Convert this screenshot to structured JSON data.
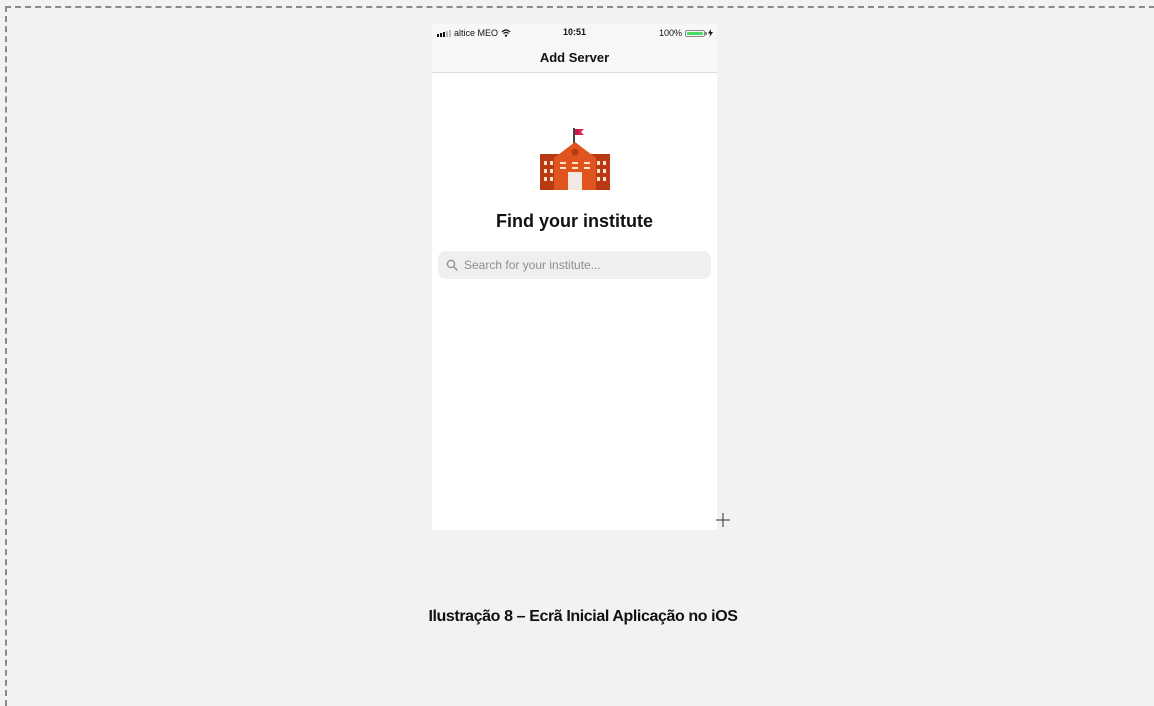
{
  "status_bar": {
    "carrier": "altice MEO",
    "time": "10:51",
    "battery": "100%"
  },
  "nav": {
    "title": "Add Server"
  },
  "main": {
    "logo_icon": "school-building-icon",
    "heading": "Find your institute",
    "search": {
      "placeholder": "Search for your institute...",
      "value": ""
    }
  },
  "caption": "Ilustração 8 – Ecrã Inicial Aplicação no iOS",
  "colors": {
    "building": "#e0541f",
    "building_dark": "#b83a12",
    "flag": "#e2285a",
    "battery": "#4cd964"
  }
}
